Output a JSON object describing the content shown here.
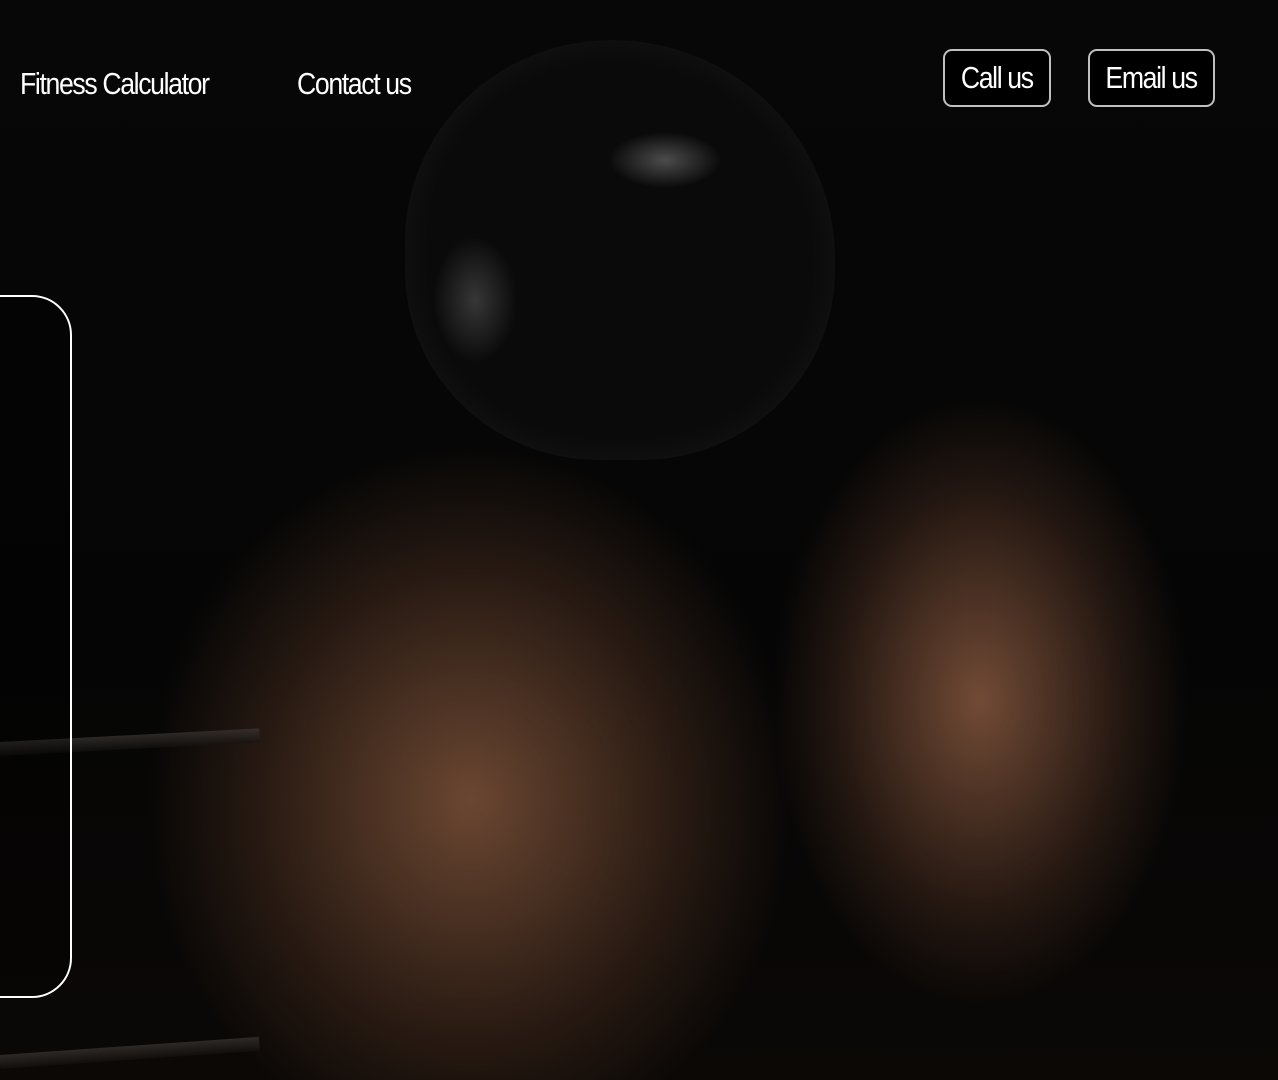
{
  "nav": {
    "items": [
      {
        "label": "Fitness Calculator"
      },
      {
        "label": "Contact us"
      }
    ]
  },
  "actions": {
    "call_label": "Call us",
    "email_label": "Email us"
  },
  "colors": {
    "background": "#050505",
    "text": "#ffffff",
    "button_bg": "#000000",
    "button_border": "#ffffff"
  },
  "hero": {
    "image": "boxers-training-photo"
  }
}
